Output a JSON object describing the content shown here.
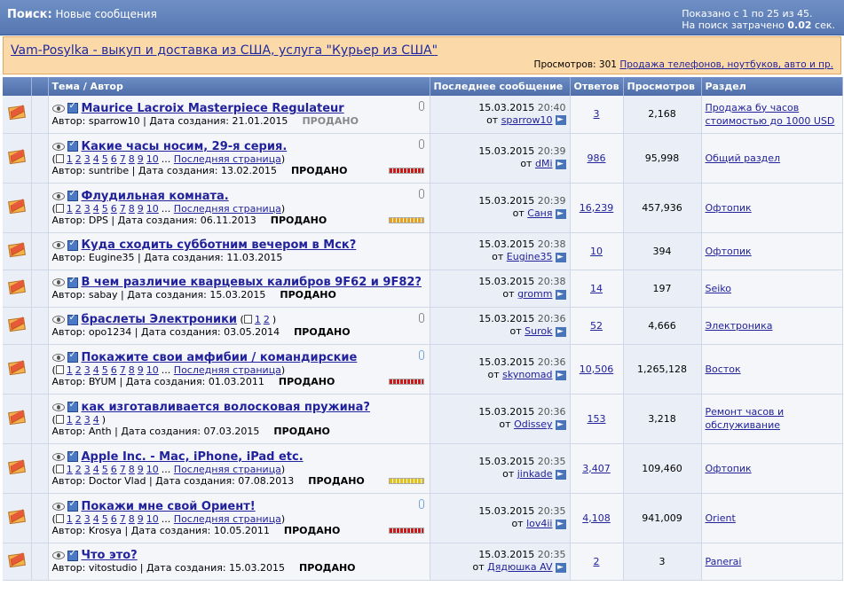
{
  "header": {
    "search_label": "Поиск:",
    "search_value": "Новые сообщения",
    "shown": "Показано с 1 по 25 из 45.",
    "time_prefix": "На поиск затрачено",
    "time_value": "0.02",
    "time_suffix": "сек."
  },
  "ad": {
    "title": "Vam-Posylka - выкуп и доставка из США, услуга \"Курьер из США\"",
    "views_label": "Просмотров: 301",
    "section_link": "Продажа телефонов, ноутбуков, авто и пр."
  },
  "columns": {
    "topic": "Тема / Автор",
    "last": "Последнее сообщение",
    "replies": "Ответов",
    "views": "Просмотров",
    "forum": "Раздел"
  },
  "labels": {
    "author": "Автор:",
    "created": "| Дата создания:",
    "from": "от",
    "last_page": "Последняя страница",
    "sold": "ПРОДАНО"
  },
  "threads": [
    {
      "title": "Maurice Lacroix Masterpiece Regulateur",
      "pages": [],
      "last_page": false,
      "author": "sparrow10",
      "created": "21.01.2015",
      "sold": "ПРОДАНО",
      "sold_gray": true,
      "attach": "gray",
      "heat": null,
      "date": "15.03.2015",
      "time": "20:40",
      "last_by": "sparrow10",
      "replies": "3",
      "views": "2,168",
      "forum": "Продажа бу часов стоимостью до 1000 USD"
    },
    {
      "title": "Какие часы носим, 29-я серия.",
      "pages": [
        "1",
        "2",
        "3",
        "4",
        "5",
        "6",
        "7",
        "8",
        "9",
        "10"
      ],
      "last_page": true,
      "author": "suntribe",
      "created": "13.02.2015",
      "sold": "ПРОДАНО",
      "sold_gray": false,
      "attach": "gray",
      "heat": "#cc1a1a",
      "date": "15.03.2015",
      "time": "20:39",
      "last_by": "dMi",
      "replies": "986",
      "views": "95,998",
      "forum": "Общий раздел"
    },
    {
      "title": "Флудильная комната.",
      "pages": [
        "1",
        "2",
        "3",
        "4",
        "5",
        "6",
        "7",
        "8",
        "9",
        "10"
      ],
      "last_page": true,
      "author": "DPS",
      "created": "06.11.2013",
      "sold": "ПРОДАНО",
      "sold_gray": false,
      "attach": "gray",
      "heat": "#e7a219",
      "date": "15.03.2015",
      "time": "20:39",
      "last_by": "Саня",
      "replies": "16,239",
      "views": "457,936",
      "forum": "Офтопик"
    },
    {
      "title": "Куда сходить субботним вечером в Мск?",
      "pages": [],
      "last_page": false,
      "author": "Eugine35",
      "created": "11.03.2015",
      "sold": "",
      "sold_gray": false,
      "attach": null,
      "heat": null,
      "date": "15.03.2015",
      "time": "20:38",
      "last_by": "Eugine35",
      "replies": "10",
      "views": "394",
      "forum": "Офтопик"
    },
    {
      "title": "В чем различие кварцевых калибров 9F62 и 9F82?",
      "pages": [],
      "last_page": false,
      "author": "sabay",
      "created": "15.03.2015",
      "sold": "ПРОДАНО",
      "sold_gray": false,
      "attach": null,
      "heat": null,
      "date": "15.03.2015",
      "time": "20:38",
      "last_by": "gromm",
      "replies": "14",
      "views": "197",
      "forum": "Seiko"
    },
    {
      "title": "браслеты Электроники",
      "pages": [
        "1",
        "2"
      ],
      "last_page": false,
      "author": "opo1234",
      "created": "03.05.2014",
      "sold": "ПРОДАНО",
      "sold_gray": false,
      "attach": "gray",
      "heat": null,
      "inline_pages": true,
      "date": "15.03.2015",
      "time": "20:36",
      "last_by": "Surok",
      "replies": "52",
      "views": "4,666",
      "forum": "Электроника"
    },
    {
      "title": "Покажите свои амфибии / командирские",
      "pages": [
        "1",
        "2",
        "3",
        "4",
        "5",
        "6",
        "7",
        "8",
        "9",
        "10"
      ],
      "last_page": true,
      "author": "BYUM",
      "created": "01.03.2011",
      "sold": "ПРОДАНО",
      "sold_gray": false,
      "attach": "blue",
      "heat": "#cc1a1a",
      "date": "15.03.2015",
      "time": "20:36",
      "last_by": "skynomad",
      "replies": "10,506",
      "views": "1,265,128",
      "forum": "Восток"
    },
    {
      "title": "как изготавливается волосковая пружина?",
      "pages": [
        "1",
        "2",
        "3",
        "4"
      ],
      "last_page": false,
      "author": "Anth",
      "created": "07.03.2015",
      "sold": "ПРОДАНО",
      "sold_gray": false,
      "attach": null,
      "heat": null,
      "date": "15.03.2015",
      "time": "20:36",
      "last_by": "Odissey",
      "replies": "153",
      "views": "3,218",
      "forum": "Ремонт часов и обслуживание"
    },
    {
      "title": "Apple Inc. - Mac, iPhone, iPad etc.",
      "pages": [
        "1",
        "2",
        "3",
        "4",
        "5",
        "6",
        "7",
        "8",
        "9",
        "10"
      ],
      "last_page": true,
      "author": "Doctor Vlad",
      "created": "07.08.2013",
      "sold": "ПРОДАНО",
      "sold_gray": false,
      "attach": null,
      "heat": "#e2c416",
      "date": "15.03.2015",
      "time": "20:35",
      "last_by": "jinkade",
      "replies": "3,407",
      "views": "109,460",
      "forum": "Офтопик"
    },
    {
      "title": "Покажи мне свой Ориент!",
      "pages": [
        "1",
        "2",
        "3",
        "4",
        "5",
        "6",
        "7",
        "8",
        "9",
        "10"
      ],
      "last_page": true,
      "author": "Krosya",
      "created": "10.05.2011",
      "sold": "ПРОДАНО",
      "sold_gray": false,
      "attach": "blue",
      "heat": "#cc1a1a",
      "date": "15.03.2015",
      "time": "20:35",
      "last_by": "lov4ii",
      "replies": "4,108",
      "views": "941,009",
      "forum": "Orient"
    },
    {
      "title": "Что это?",
      "pages": [],
      "last_page": false,
      "author": "vitostudio",
      "created": "15.03.2015",
      "sold": "ПРОДАНО",
      "sold_gray": false,
      "attach": null,
      "heat": null,
      "date": "15.03.2015",
      "time": "20:35",
      "last_by": "Дядюшка AV",
      "replies": "2",
      "views": "3",
      "forum": "Panerai"
    }
  ]
}
